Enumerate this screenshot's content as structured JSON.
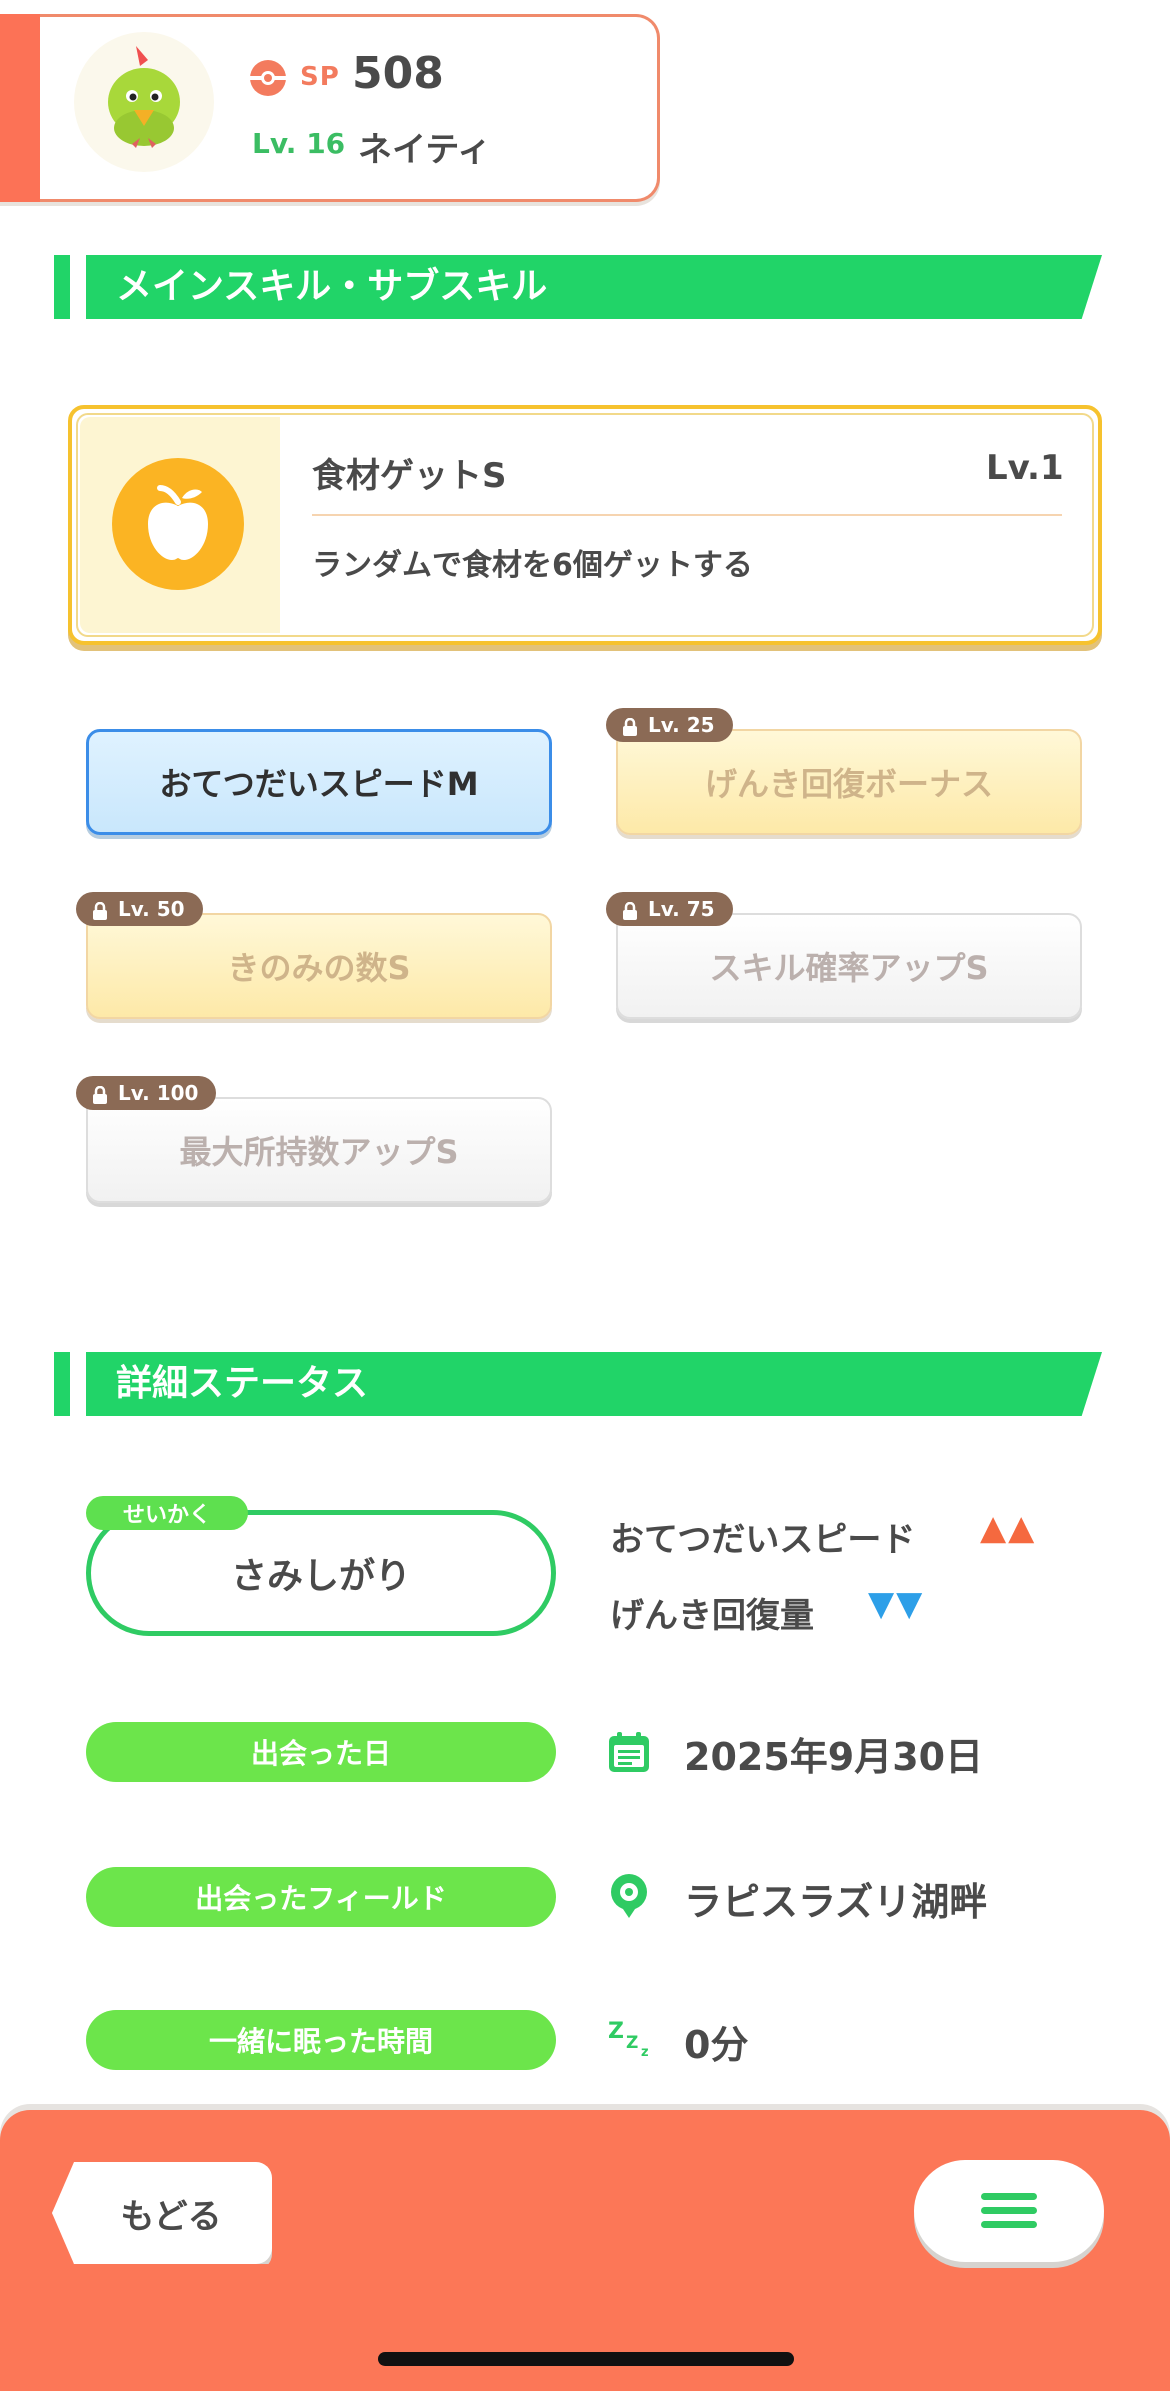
{
  "pokemon": {
    "sp_label": "SP",
    "sp_value": "508",
    "level": "Lv. 16",
    "name": "ネイティ"
  },
  "skills_section": {
    "title": "メインスキル・サブスキル"
  },
  "main_skill": {
    "name": "食材ゲットS",
    "level": "Lv.1",
    "description": "ランダムで食材を6個ゲットする",
    "icon": "apple-icon"
  },
  "sub_skills": [
    {
      "name": "おてつだいスピードM",
      "unlock_level": "",
      "state": "unlocked"
    },
    {
      "name": "げんき回復ボーナス",
      "unlock_level": "Lv. 25",
      "state": "locked-gold"
    },
    {
      "name": "きのみの数S",
      "unlock_level": "Lv. 50",
      "state": "locked-gold"
    },
    {
      "name": "スキル確率アップS",
      "unlock_level": "Lv. 75",
      "state": "locked-white"
    },
    {
      "name": "最大所持数アップS",
      "unlock_level": "Lv. 100",
      "state": "locked-white"
    }
  ],
  "status_section": {
    "title": "詳細ステータス"
  },
  "nature": {
    "tag": "せいかく",
    "value": "さみしがり",
    "up_stat": "おてつだいスピード",
    "up_marks": "▲▲",
    "down_stat": "げんき回復量",
    "down_marks": "▼▼"
  },
  "details": {
    "met_date_label": "出会った日",
    "met_date_value": "2025年9月30日",
    "met_field_label": "出会ったフィールド",
    "met_field_value": "ラピスラズリ湖畔",
    "sleep_time_label": "一緒に眠った時間",
    "sleep_time_value": "0分"
  },
  "nav": {
    "back_label": "もどる",
    "menu_icon": "hamburger-icon"
  },
  "colors": {
    "accent_orange": "#fc7757",
    "section_green": "#21d468",
    "pill_green": "#6ce54b",
    "up_color": "#f5693f",
    "down_color": "#2d9fe8"
  }
}
